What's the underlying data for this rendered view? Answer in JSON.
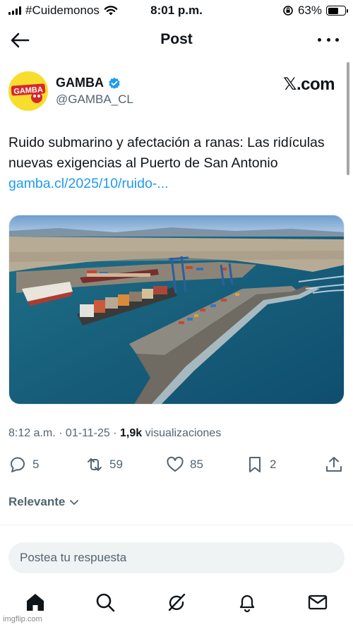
{
  "status_bar": {
    "carrier": "#Cuidemonos",
    "time": "8:01 p.m.",
    "battery": "63%",
    "battery_level": 0.63
  },
  "header": {
    "title": "Post"
  },
  "author": {
    "name": "GAMBA",
    "handle": "@GAMBA_CL",
    "avatar_text": "GAMBA",
    "source_label": "𝕏.com",
    "brand_color": "#f7de2e",
    "verified_color": "#1d9bf0"
  },
  "tweet": {
    "text": "Ruido submarino y afectación a ranas: Las ridículas nuevas exigencias al Puerto de San Antonio ",
    "link": "gamba.cl/2025/10/ruido-..."
  },
  "meta": {
    "time": "8:12 a.m.",
    "date": "01-11-25",
    "views_count": "1,9k",
    "views_label": "visualizaciones"
  },
  "actions": {
    "replies": "5",
    "reposts": "59",
    "likes": "85",
    "bookmarks": "2"
  },
  "sort": {
    "label": "Relevante"
  },
  "reply_box": {
    "placeholder": "Postea tu respuesta"
  },
  "nav": {
    "items": [
      "home-icon",
      "search-icon",
      "grok-icon",
      "notifications-icon",
      "messages-icon"
    ]
  },
  "watermark": "imgflip.com"
}
